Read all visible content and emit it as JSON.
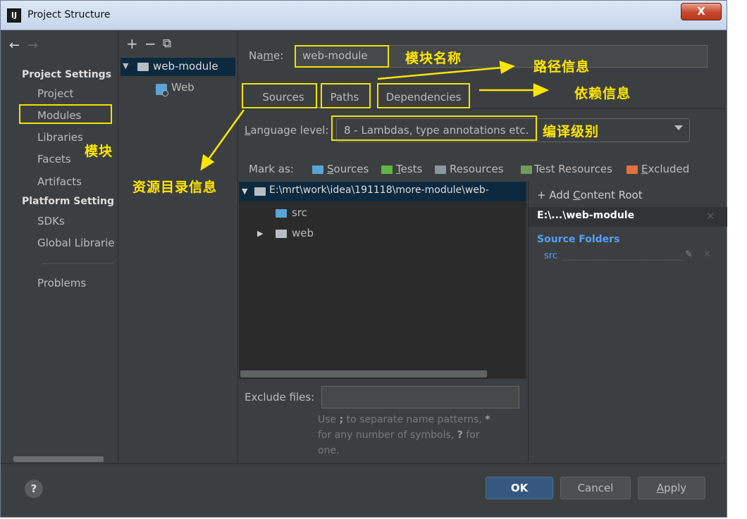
{
  "window": {
    "title": "Project Structure",
    "app_icon": "IJ",
    "close_label": "X"
  },
  "nav": {
    "back_glyph": "←",
    "forward_glyph": "→",
    "project_settings_header": "Project Settings",
    "project_settings_items": [
      "Project",
      "Modules",
      "Libraries",
      "Facets",
      "Artifacts"
    ],
    "platform_settings_header": "Platform Setting",
    "platform_settings_items": [
      "SDKs",
      "Global Librarie"
    ],
    "problems": "Problems",
    "selected": "Modules"
  },
  "module_tree": {
    "toolbar": {
      "add": "+",
      "remove": "−",
      "copy": "⧉"
    },
    "module": "web-module",
    "facet": "Web"
  },
  "main": {
    "name_label": "Na",
    "name_label_mnemonic": "m",
    "name_label_rest": "e:",
    "name_value": "web-module",
    "tabs": [
      "Sources",
      "Paths",
      "Dependencies"
    ],
    "language_level_label": "Language level:",
    "language_level_mnemonic": "L",
    "language_level_rest": "anguage level:",
    "language_level_value": "8 - Lambdas, type annotations etc.",
    "mark_as_label": "Mark as:",
    "mark_as": {
      "sources": {
        "mnemonic": "S",
        "rest": "ources"
      },
      "tests": {
        "mnemonic": "T",
        "rest": "ests"
      },
      "resources": "Resources",
      "test_resources": "Test Resources",
      "excluded": {
        "mnemonic": "E",
        "rest": "xcluded"
      }
    },
    "tree": {
      "root": "E:\\mrt\\work\\idea\\191118\\more-module\\web-",
      "children": [
        "src",
        "web"
      ]
    },
    "content_root": {
      "add_label": "+ Add ",
      "add_mnemonic": "C",
      "add_rest": "ontent Root",
      "root_path": "E:\\...\\web-module",
      "source_folders_header": "Source Folders",
      "source_folders": [
        "src"
      ]
    },
    "exclude_files_label": "Exclude files:",
    "hint": {
      "line1_a": "Use ",
      "line1_b": ";",
      "line1_c": " to separate name patterns, ",
      "line1_d": "*",
      "line2_a": "for any number of symbols, ",
      "line2_b": "?",
      "line2_c": " for",
      "line3": "one."
    }
  },
  "annotations": {
    "module_name": "模块名称",
    "path_info": "路径信息",
    "dependency_info": "依赖信息",
    "compile_level": "编译级别",
    "modules": "模块",
    "source_dir_info": "资源目录信息"
  },
  "footer": {
    "help": "?",
    "ok": "OK",
    "cancel": "Cancel",
    "apply_mnemonic": "A",
    "apply_rest": "pply"
  },
  "colors": {
    "annotation": "#ffe600",
    "background": "#3c3f41",
    "selection": "#0d293e",
    "link": "#589df6",
    "sources_folder": "#5aa4d6",
    "tests_folder": "#62b543",
    "excluded_folder": "#e0733b"
  }
}
